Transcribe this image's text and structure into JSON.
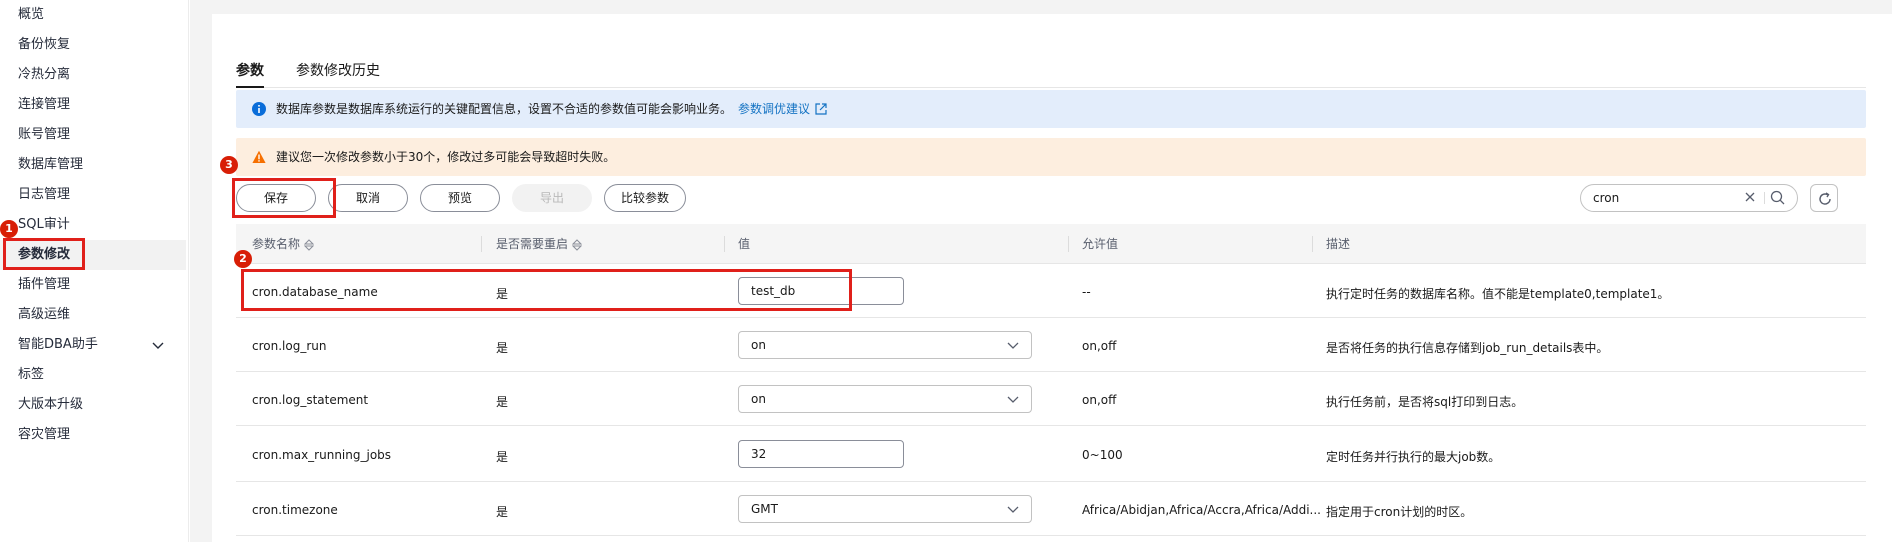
{
  "sidebar": {
    "items": [
      {
        "label": "概览"
      },
      {
        "label": "备份恢复"
      },
      {
        "label": "冷热分离"
      },
      {
        "label": "连接管理"
      },
      {
        "label": "账号管理"
      },
      {
        "label": "数据库管理"
      },
      {
        "label": "日志管理"
      },
      {
        "label": "SQL审计"
      },
      {
        "label": "参数修改"
      },
      {
        "label": "插件管理"
      },
      {
        "label": "高级运维"
      },
      {
        "label": "智能DBA助手"
      },
      {
        "label": "标签"
      },
      {
        "label": "大版本升级"
      },
      {
        "label": "容灾管理"
      }
    ]
  },
  "tabs": [
    {
      "label": "参数"
    },
    {
      "label": "参数修改历史"
    }
  ],
  "alerts": {
    "info_text": "数据库参数是数据库系统运行的关键配置信息，设置不合适的参数值可能会影响业务。",
    "info_link": "参数调优建议",
    "warn_text": "建议您一次修改参数小于30个，修改过多可能会导致超时失败。"
  },
  "toolbar": {
    "save": "保存",
    "cancel": "取消",
    "preview": "预览",
    "export": "导出",
    "compare": "比较参数",
    "search_value": "cron"
  },
  "table": {
    "headers": [
      "参数名称",
      "是否需要重启",
      "值",
      "允许值",
      "描述"
    ],
    "rows": [
      {
        "name": "cron.database_name",
        "restart": "是",
        "value": "test_db",
        "control": "input",
        "allowed": "--",
        "desc": "执行定时任务的数据库名称。值不能是template0,template1。"
      },
      {
        "name": "cron.log_run",
        "restart": "是",
        "value": "on",
        "control": "select",
        "allowed": "on,off",
        "desc": "是否将任务的执行信息存储到job_run_details表中。"
      },
      {
        "name": "cron.log_statement",
        "restart": "是",
        "value": "on",
        "control": "select",
        "allowed": "on,off",
        "desc": "执行任务前，是否将sql打印到日志。"
      },
      {
        "name": "cron.max_running_jobs",
        "restart": "是",
        "value": "32",
        "control": "input",
        "allowed": "0~100",
        "desc": "定时任务并行执行的最大job数。"
      },
      {
        "name": "cron.timezone",
        "restart": "是",
        "value": "GMT",
        "control": "select",
        "allowed": "Africa/Abidjan,Africa/Accra,Africa/Addi...",
        "desc": "指定用于cron计划的时区。"
      }
    ]
  },
  "annotations": [
    "1",
    "2",
    "3"
  ],
  "colors": {
    "highlight": "#e0201a",
    "badge": "#d81e06",
    "info_bg": "#e3edfb",
    "warn_bg": "#fdeedf",
    "link": "#1473c3"
  }
}
